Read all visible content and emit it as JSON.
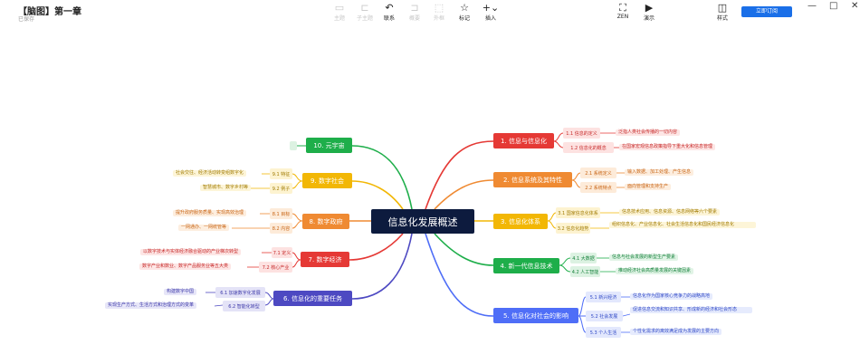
{
  "header": {
    "title": "【脑图】第一章",
    "subtitle": "已保存",
    "tools": [
      "主题",
      "子主题",
      "联系",
      "概要",
      "外框",
      "标记",
      "插入"
    ],
    "right_tools": [
      "ZEN",
      "演示",
      "样式"
    ],
    "subscribe_label": "立即订阅",
    "window_controls": [
      "—",
      "□",
      "✕"
    ]
  },
  "mindmap": {
    "root": "信息化发展概述",
    "colors": {
      "red": "#e53935",
      "orange": "#ef8a32",
      "yellow": "#f2b705",
      "green": "#1eae4a",
      "blue": "#4f6ef7",
      "purple": "#4d49c2",
      "teal": "#1ab48a",
      "lightgreen": "#e4f3e7"
    },
    "right": [
      {
        "label": "1. 信息与信息化",
        "children": [
          {
            "label": "1.1 信息的定义",
            "detail": "泛指人类社会传播的一切内容"
          },
          {
            "label": "1.2 信息化的概念",
            "detail": "在国家宏观信息政策指导下重大化和信息管理"
          }
        ]
      },
      {
        "label": "2. 信息系统及其特性",
        "children": [
          {
            "label": "2.1 系统定义",
            "detail": "输入数据、加工处理、产生信息"
          },
          {
            "label": "2.2 系统特点",
            "detail": "面向管理和支持生产"
          }
        ]
      },
      {
        "label": "3. 信息化体系",
        "children": [
          {
            "label": "3.1 国家信息化体系",
            "detail": "信息技术应用、信息资源、信息网络等六个要素"
          },
          {
            "label": "3.2 信息化趋势",
            "detail": "组织信息化、产业信息化、社会生活信息化和国民经济信息化"
          }
        ]
      },
      {
        "label": "4. 新一代信息技术",
        "children": [
          {
            "label": "4.1 大数据",
            "detail": "信息与社会发展的新型生产要素"
          },
          {
            "label": "4.2 人工智能",
            "detail": "推动经济社会高质量发展的关键因素"
          }
        ]
      },
      {
        "label": "5. 信息化对社会的影响",
        "children": [
          {
            "label": "5.1 新兴经济",
            "detail": "信息化作为国家核心竞争力的战略高地"
          },
          {
            "label": "5.2 社会发展",
            "detail": "促进信息交流和知识共享、形成新的经济和社会形态"
          },
          {
            "label": "5.3 个人生活",
            "detail": "个性化需求的离效满足成为发展的主要方向"
          }
        ]
      }
    ],
    "left": [
      {
        "label": "10. 元宇宙",
        "children": []
      },
      {
        "label": "9. 数字社会",
        "children": [
          {
            "label": "9.1 特征",
            "detail": "社会交往、经济活动转变组数字化"
          },
          {
            "label": "9.2 例子",
            "detail": "智慧城市、数字乡村等"
          }
        ]
      },
      {
        "label": "8. 数字政府",
        "children": [
          {
            "label": "8.1 目标",
            "detail": "提升政府服务质量、实现高效治理"
          },
          {
            "label": "8.2 内容",
            "detail": "一网通办、一网统管等"
          }
        ]
      },
      {
        "label": "7. 数字经济",
        "children": [
          {
            "label": "7.1 定义",
            "detail": "以数字技术与实体经济融合驱动的产业梯次转型"
          },
          {
            "label": "7.2 核心产业",
            "detail": "数字产业和数业、数字产品服务业等五大类"
          }
        ]
      },
      {
        "label": "6. 信息化的重要任务",
        "children": [
          {
            "label": "6.1 加速数字化发展",
            "detail": "构建数字中国"
          },
          {
            "label": "6.2 智能化转型",
            "detail": "实现生产方式、生活方式和治理方式的变革"
          }
        ]
      }
    ]
  }
}
